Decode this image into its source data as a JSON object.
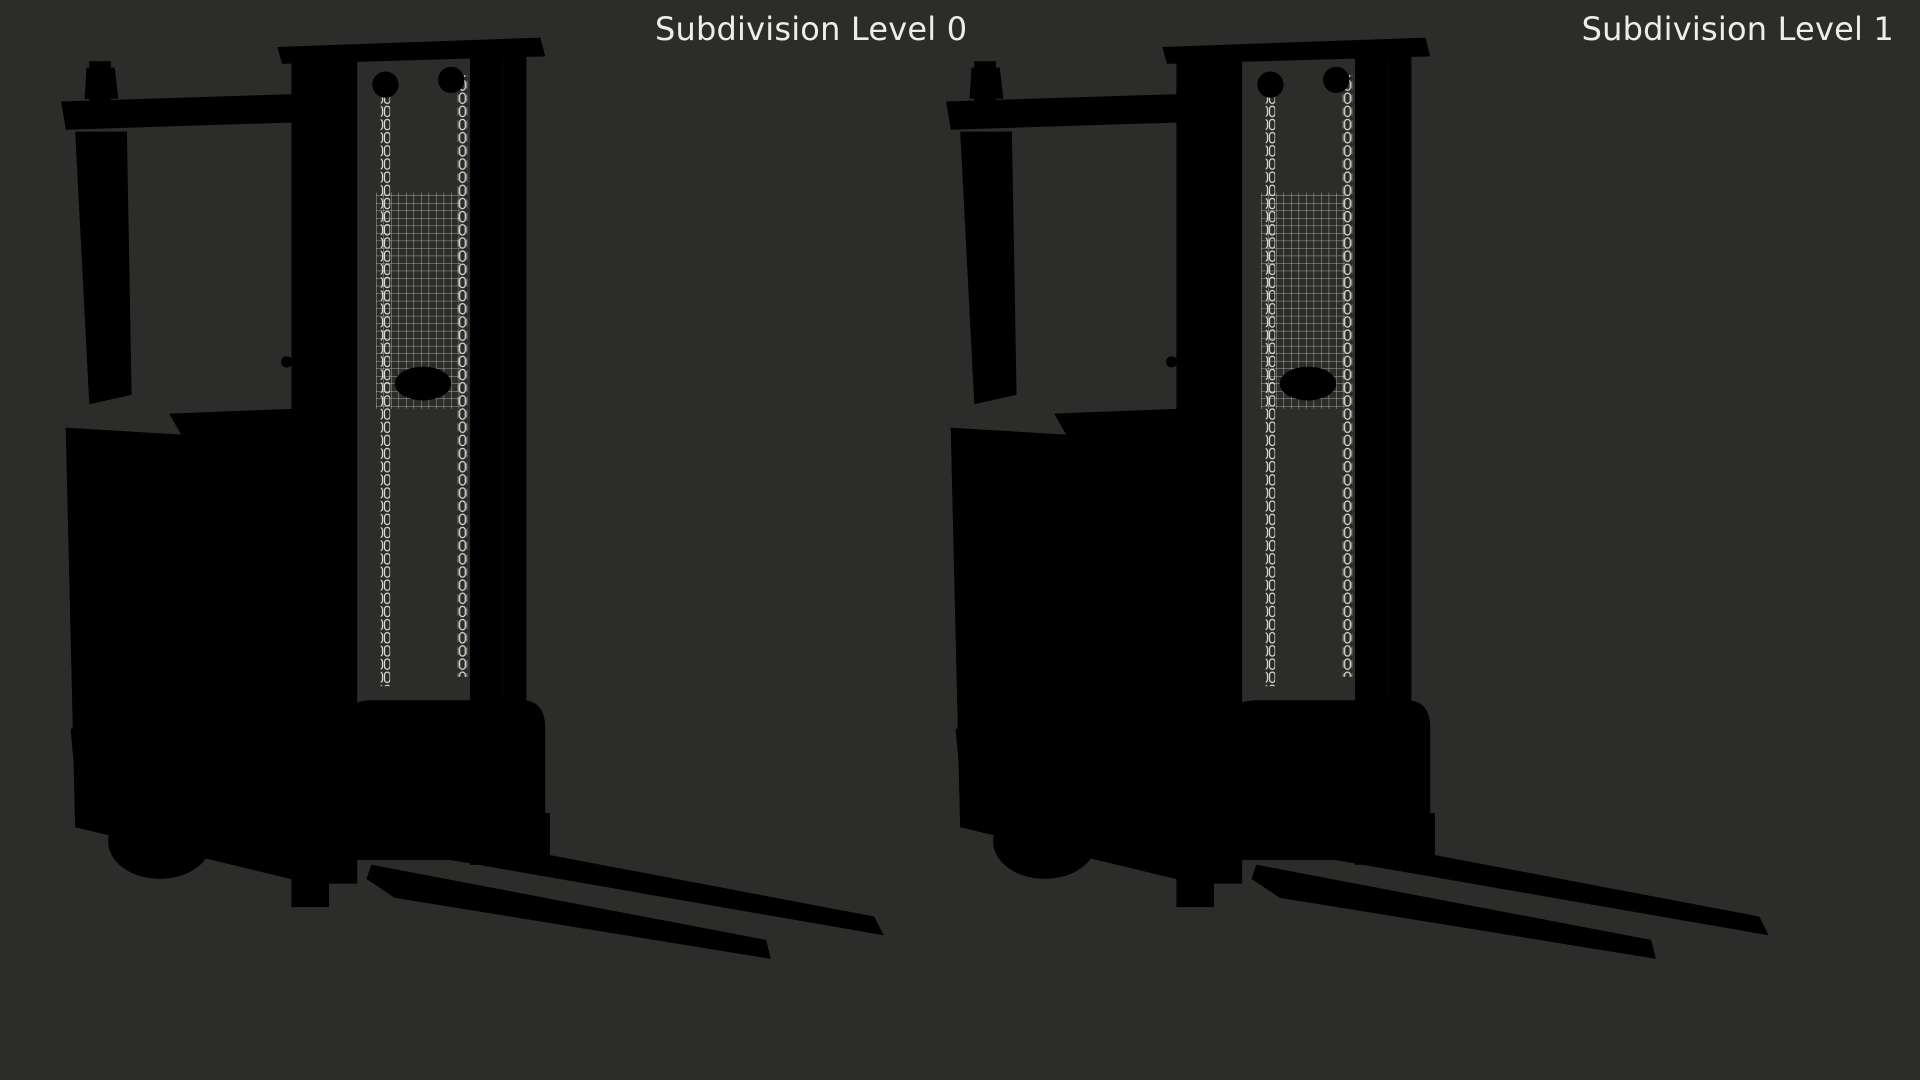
{
  "panels": {
    "left": {
      "label": "Subdivision Level 0"
    },
    "right": {
      "label": "Subdivision Level 1"
    }
  },
  "colors": {
    "background": "#2c2c2b",
    "model_fill": "#66665f",
    "model_fill_dark": "#4f4f4a",
    "wire_level0": "#cfcfc4",
    "wire_level1": "#e4e4da",
    "label_text": "#ededea"
  }
}
